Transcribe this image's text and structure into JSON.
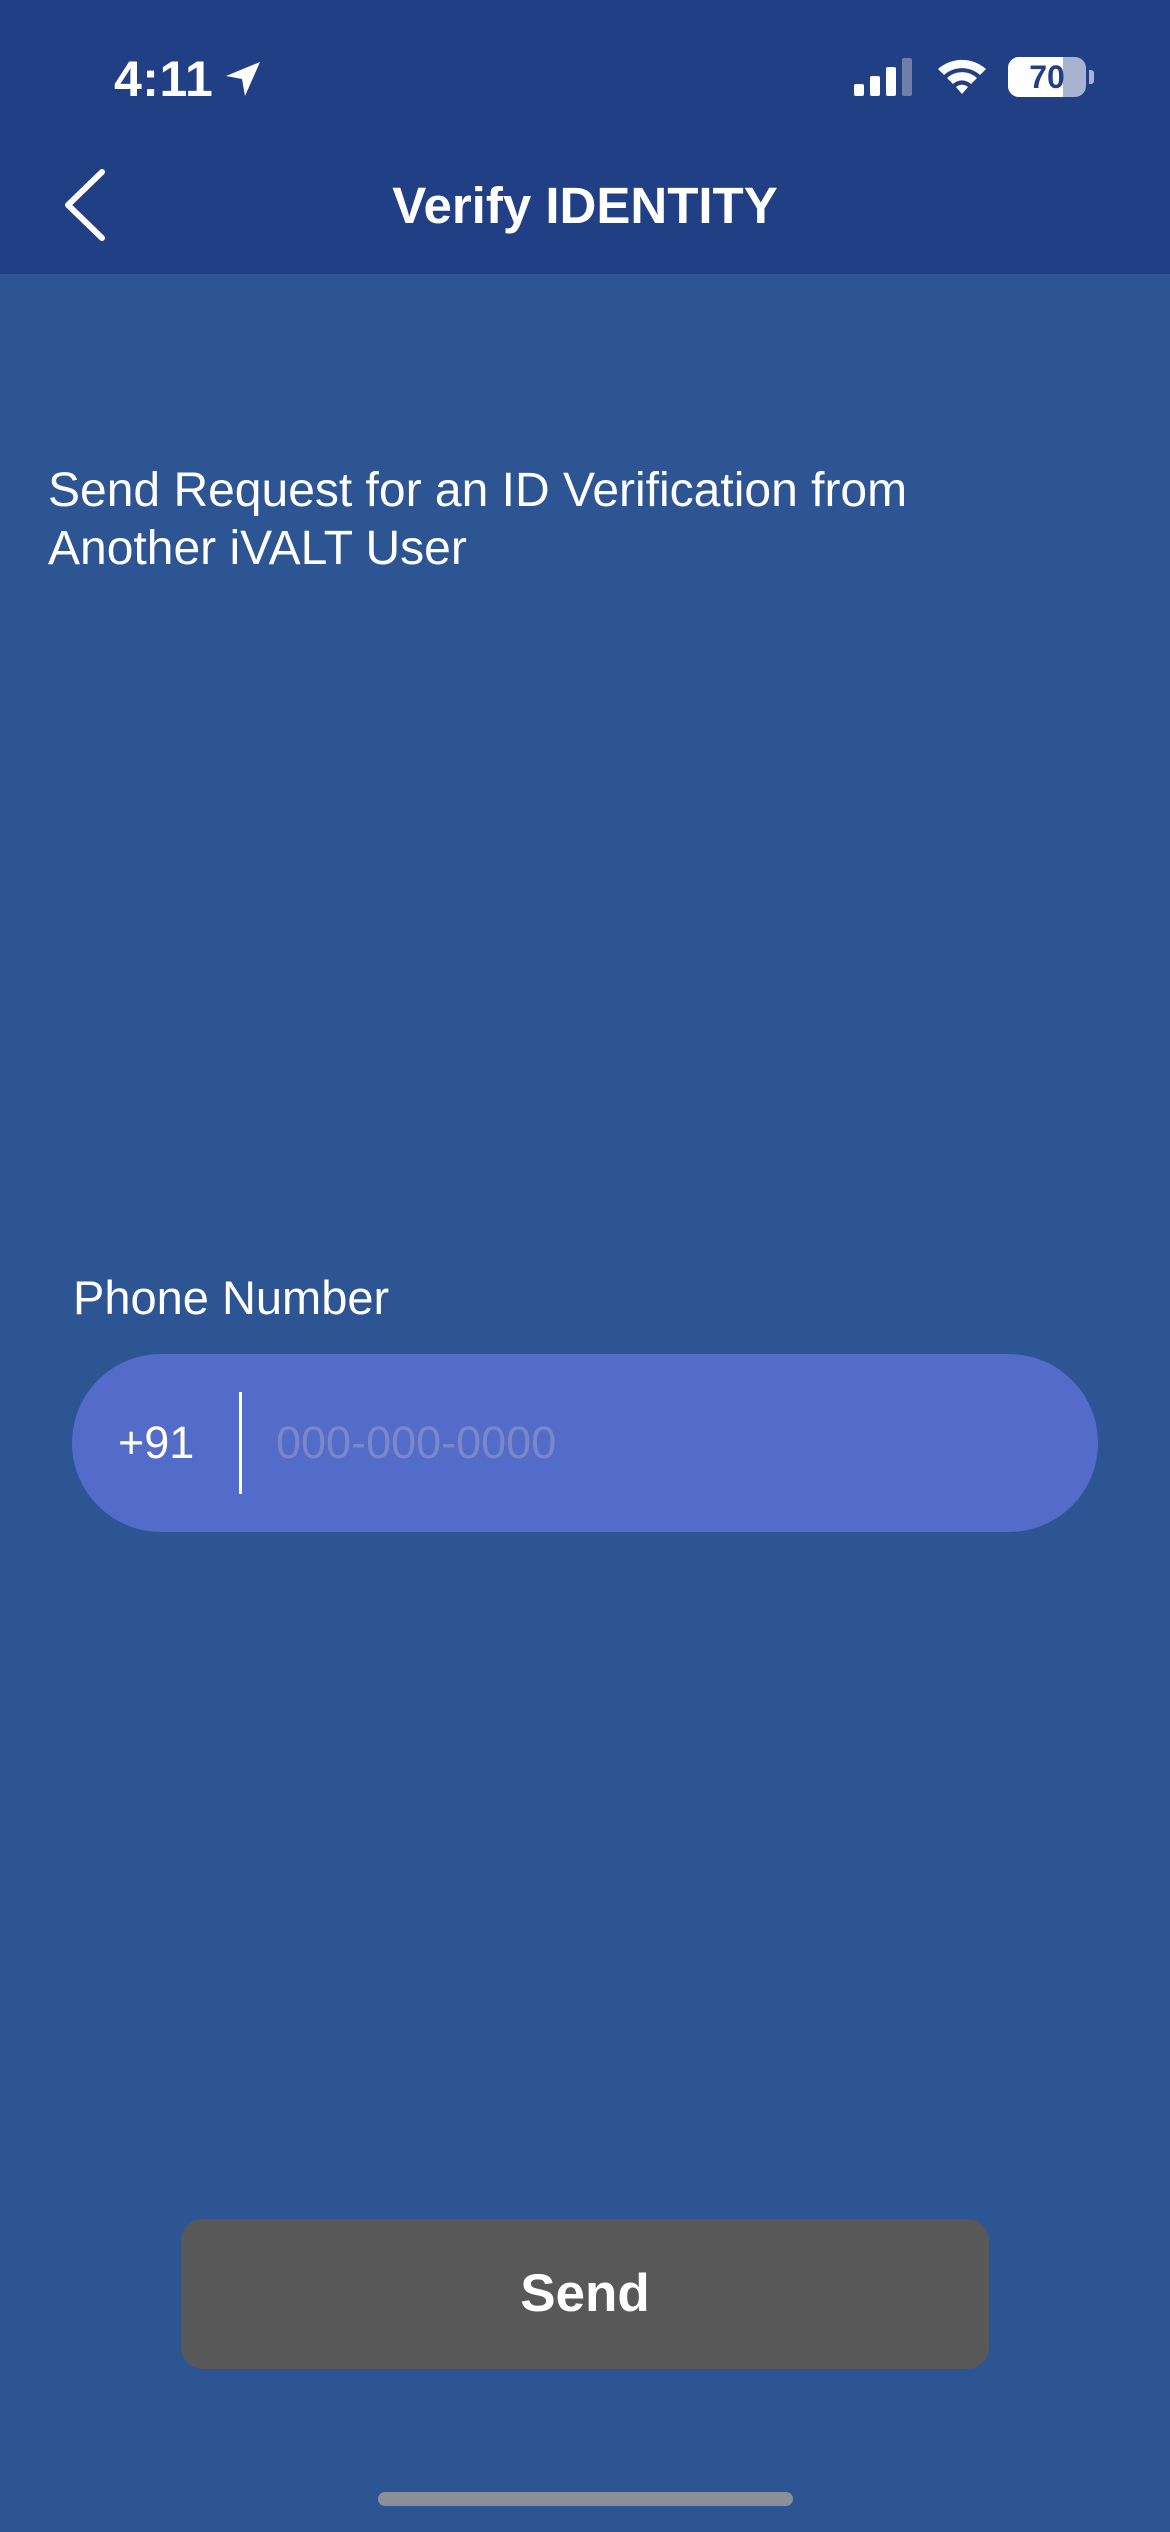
{
  "status_bar": {
    "time": "4:11",
    "battery_percent": "70",
    "battery_level": 0.7,
    "signal_bars_active": 3,
    "signal_bars_total": 4,
    "icons": [
      "location-arrow-icon",
      "cellular-signal-icon",
      "wifi-icon",
      "battery-icon"
    ]
  },
  "nav": {
    "back_icon": "chevron-left-icon",
    "title": "Verify IDENTITY"
  },
  "main": {
    "intro_line_1": "Send Request for an ID Verification from",
    "intro_line_2": "Another iVALT User",
    "phone_label": "Phone Number",
    "country_code": "+91",
    "phone_value": "",
    "phone_placeholder": "000-000-0000",
    "send_label": "Send"
  },
  "colors": {
    "header_bg": "#213f84",
    "page_bg": "#2d5594",
    "input_bg": "#536bc9",
    "send_button_bg": "#585858",
    "placeholder": "#7b87c8"
  }
}
